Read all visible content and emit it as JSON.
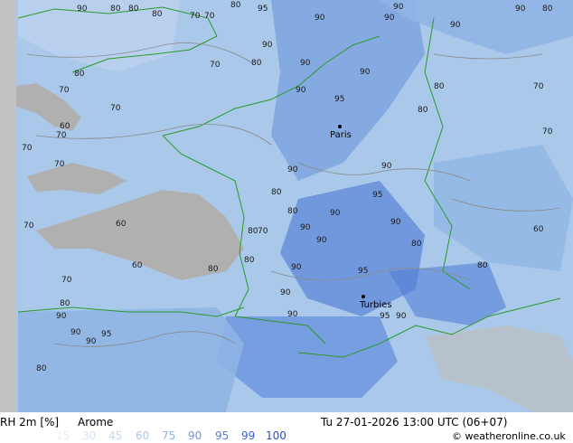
{
  "footer": {
    "parameter": "RH 2m [%]",
    "model": "Arome",
    "valid_time": "Tu 27-01-2026 13:00 UTC (06+07)",
    "credit": "© weatheronline.co.uk"
  },
  "legend": [
    {
      "value": "15",
      "color": "#e6eef8"
    },
    {
      "value": "30",
      "color": "#d6e3f2"
    },
    {
      "value": "45",
      "color": "#c2d6ee"
    },
    {
      "value": "60",
      "color": "#a9c8ea"
    },
    {
      "value": "75",
      "color": "#8fb4e4"
    },
    {
      "value": "90",
      "color": "#6e96de"
    },
    {
      "value": "95",
      "color": "#547fd6"
    },
    {
      "value": "99",
      "color": "#3b63cc"
    },
    {
      "value": "100",
      "color": "#2a4fc0"
    }
  ],
  "cities": [
    {
      "name": "Paris"
    },
    {
      "name": "Turbies"
    }
  ],
  "map_labels": [
    "90",
    "80",
    "80",
    "80",
    "70",
    "70",
    "80",
    "95",
    "90",
    "90",
    "90",
    "90",
    "90",
    "80",
    "90",
    "90",
    "80",
    "70",
    "70",
    "90",
    "90",
    "70",
    "80",
    "95",
    "80",
    "90",
    "90",
    "80",
    "80",
    "90",
    "95",
    "90",
    "80",
    "70",
    "90",
    "80",
    "90",
    "80",
    "95",
    "90",
    "70",
    "70",
    "70",
    "90",
    "90",
    "95",
    "90",
    "80",
    "60",
    "70",
    "70",
    "60",
    "80",
    "90",
    "90",
    "95",
    "90",
    "60",
    "80",
    "80",
    "70",
    "70",
    "60",
    "80"
  ]
}
